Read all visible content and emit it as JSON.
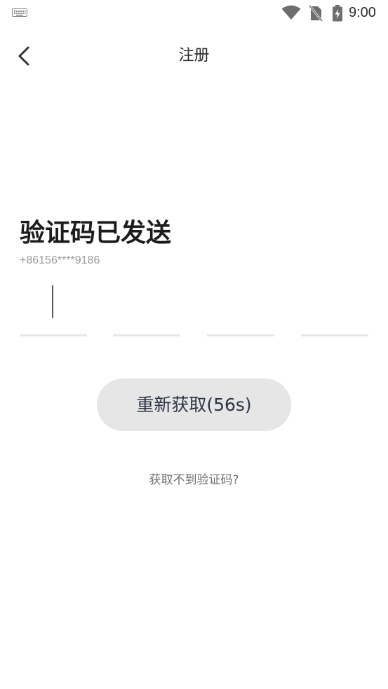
{
  "status_bar": {
    "time": "9:00",
    "icons": [
      "keyboard-icon",
      "wifi-icon",
      "no-sim-icon",
      "battery-charging-icon"
    ]
  },
  "header": {
    "back_icon": "chevron-left-icon",
    "title": "注册"
  },
  "verification": {
    "heading": "验证码已发送",
    "phone": "+86156****9186",
    "code_digits": [
      "",
      "",
      "",
      ""
    ]
  },
  "actions": {
    "resend_label": "重新获取(56s)",
    "help_label": "获取不到验证码?"
  },
  "colors": {
    "background": "#ffffff",
    "underline": "#e6e6e6",
    "button_bg": "#e6e6e6",
    "button_text": "#2c3346",
    "muted_text": "#9a9a9a"
  }
}
